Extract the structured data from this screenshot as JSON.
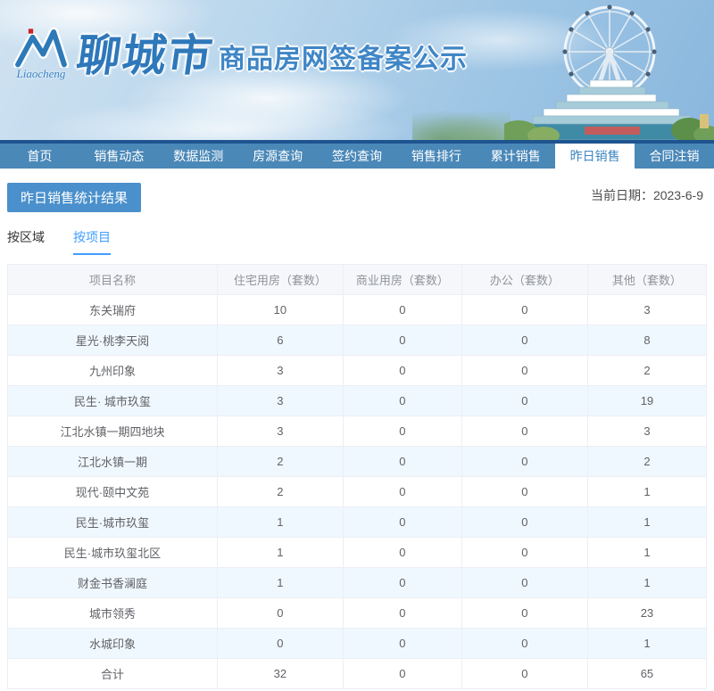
{
  "banner": {
    "logo_script": "Liaocheng",
    "city_name": "聊城市",
    "site_subtitle": "商品房网签备案公示"
  },
  "nav": {
    "items": [
      {
        "label": "首页",
        "active": false
      },
      {
        "label": "销售动态",
        "active": false
      },
      {
        "label": "数据监测",
        "active": false
      },
      {
        "label": "房源查询",
        "active": false
      },
      {
        "label": "签约查询",
        "active": false
      },
      {
        "label": "销售排行",
        "active": false
      },
      {
        "label": "累计销售",
        "active": false
      },
      {
        "label": "昨日销售",
        "active": true
      },
      {
        "label": "合同注销",
        "active": false
      }
    ]
  },
  "main": {
    "section_title": "昨日销售统计结果",
    "current_date": "当前日期：2023-6-9",
    "tabs": [
      {
        "label": "按区域",
        "active": false
      },
      {
        "label": "按项目",
        "active": true
      }
    ]
  },
  "table": {
    "headers": [
      "项目名称",
      "住宅用房（套数）",
      "商业用房（套数）",
      "办公（套数）",
      "其他（套数）"
    ],
    "rows": [
      {
        "name": "东关瑞府",
        "residential": "10",
        "commercial": "0",
        "office": "0",
        "other": "3"
      },
      {
        "name": "星光·桃李天阅",
        "residential": "6",
        "commercial": "0",
        "office": "0",
        "other": "8"
      },
      {
        "name": "九州印象",
        "residential": "3",
        "commercial": "0",
        "office": "0",
        "other": "2"
      },
      {
        "name": "民生· 城市玖玺",
        "residential": "3",
        "commercial": "0",
        "office": "0",
        "other": "19"
      },
      {
        "name": "江北水镇一期四地块",
        "residential": "3",
        "commercial": "0",
        "office": "0",
        "other": "3"
      },
      {
        "name": "江北水镇一期",
        "residential": "2",
        "commercial": "0",
        "office": "0",
        "other": "2"
      },
      {
        "name": "现代·颐中文苑",
        "residential": "2",
        "commercial": "0",
        "office": "0",
        "other": "1"
      },
      {
        "name": "民生·城市玖玺",
        "residential": "1",
        "commercial": "0",
        "office": "0",
        "other": "1"
      },
      {
        "name": "民生·城市玖玺北区",
        "residential": "1",
        "commercial": "0",
        "office": "0",
        "other": "1"
      },
      {
        "name": "财金书香澜庭",
        "residential": "1",
        "commercial": "0",
        "office": "0",
        "other": "1"
      },
      {
        "name": "城市领秀",
        "residential": "0",
        "commercial": "0",
        "office": "0",
        "other": "23"
      },
      {
        "name": "水城印象",
        "residential": "0",
        "commercial": "0",
        "office": "0",
        "other": "1"
      }
    ],
    "total": {
      "name": "合计",
      "residential": "32",
      "commercial": "0",
      "office": "0",
      "other": "65"
    }
  },
  "colors": {
    "nav_blue": "#4a88b8",
    "nav_edge_dark": "#1e5490",
    "badge_blue": "#4a90cc",
    "tab_active_blue": "#409eff",
    "table_header_bg": "#f5f7fa",
    "table_stripe_bg": "#f0f8ff",
    "table_border": "#ebeef5",
    "brand_blue": "#2e78ba"
  }
}
